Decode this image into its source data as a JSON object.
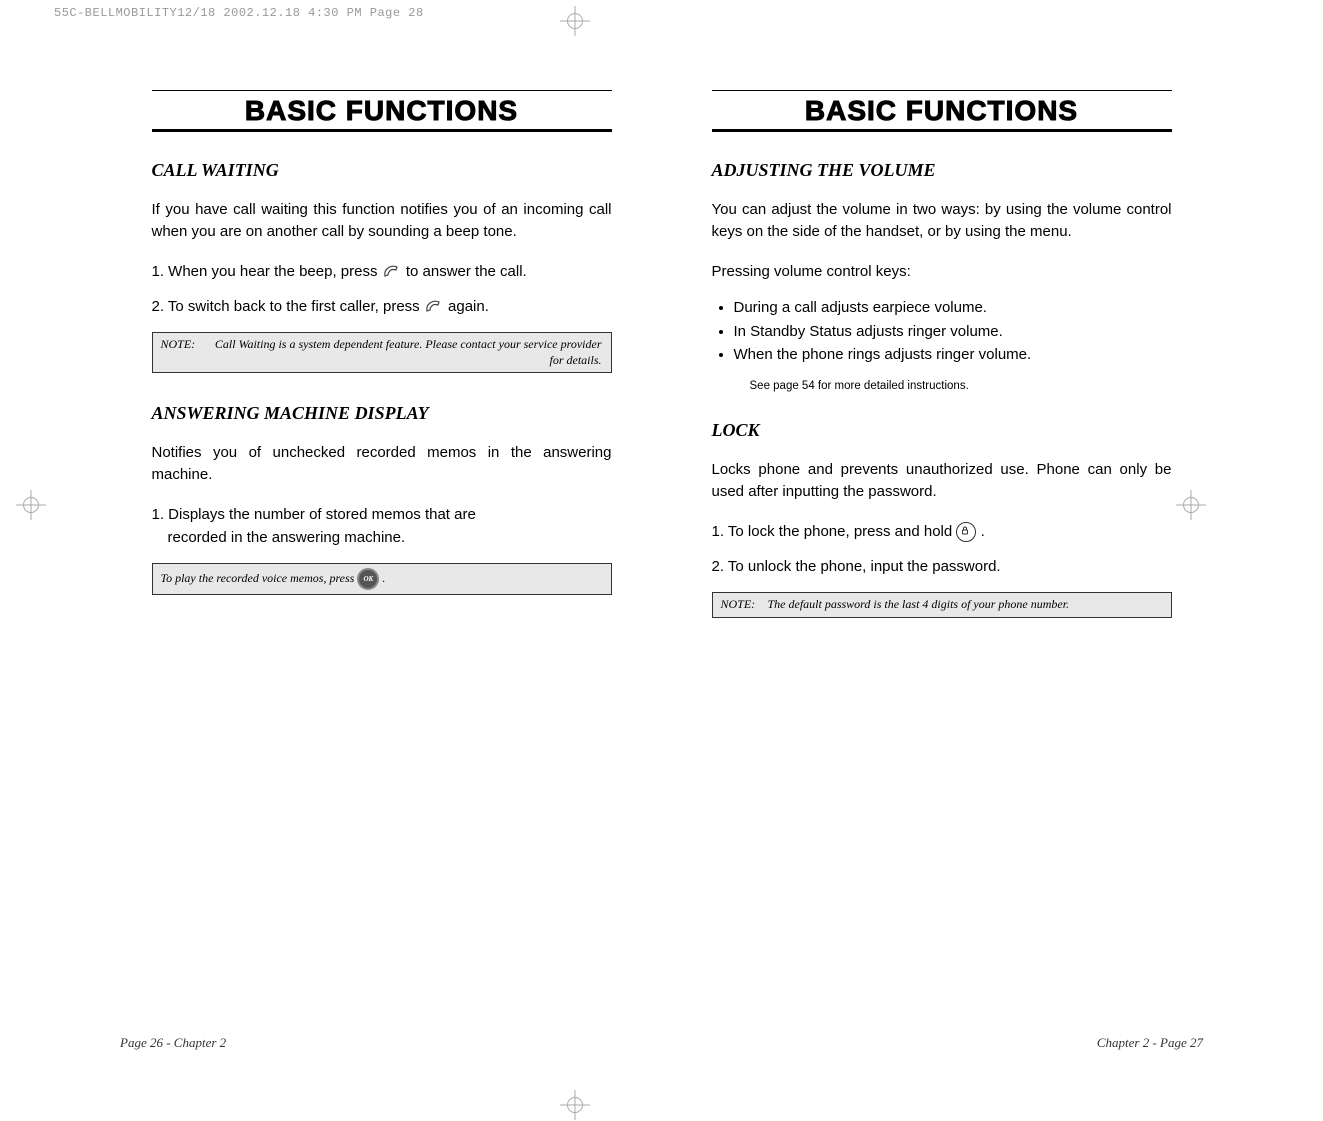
{
  "printmeta": {
    "header": "55C-BELLMOBILITY12/18  2002.12.18  4:30 PM  Page 28"
  },
  "left": {
    "title": "BASIC FUNCTIONS",
    "call_waiting": {
      "heading": "CALL WAITING",
      "intro": "If you have call waiting this function notifies you of an incoming call when you are on another call by sounding a beep tone.",
      "step1_a": "1. When you hear the beep, press",
      "step1_b": "to answer the call.",
      "step2_a": "2. To switch back to the first caller, press",
      "step2_b": "again.",
      "note_label": "NOTE:",
      "note_text": "Call Waiting is a system dependent feature. Please contact your service provider for details."
    },
    "amd": {
      "heading": "ANSWERING MACHINE DISPLAY",
      "intro": "Notifies you of unchecked recorded memos in the answering machine.",
      "step1_a": "1. Displays the number of stored memos that are",
      "step1_b": "recorded in the answering machine.",
      "play_a": "To play the recorded voice memos, press",
      "play_b": "."
    },
    "footer": "Page 26 - Chapter 2"
  },
  "right": {
    "title": "BASIC FUNCTIONS",
    "volume": {
      "heading": "ADJUSTING THE VOLUME",
      "intro": "You can adjust the volume in two ways: by using the volume control keys on the side of the handset, or by using the menu.",
      "sub": "Pressing volume control keys:",
      "bullets": [
        "During a call adjusts earpiece volume.",
        "In Standby Status adjusts ringer volume.",
        "When the phone rings adjusts ringer volume."
      ],
      "seealso": "See page 54 for more detailed instructions."
    },
    "lock": {
      "heading": "LOCK",
      "intro": "Locks phone and prevents unauthorized use. Phone can only be used after inputting the password.",
      "step1_a": "1. To lock the phone, press and hold",
      "step1_b": ".",
      "step2": "2. To unlock the phone, input the password.",
      "note_label": "NOTE:",
      "note_text": "The default password is the last 4 digits of your phone number."
    },
    "footer": "Chapter 2 - Page 27"
  },
  "icons": {
    "ok": "OK"
  }
}
